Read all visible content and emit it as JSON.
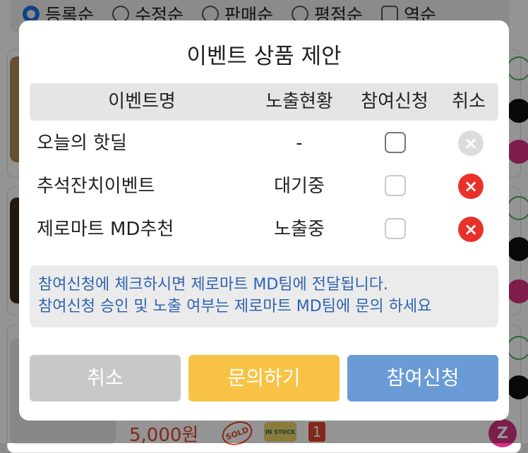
{
  "sort_options": [
    {
      "label": "등록순",
      "selected": true,
      "kind": "radio"
    },
    {
      "label": "수정순",
      "selected": false,
      "kind": "radio"
    },
    {
      "label": "판매순",
      "selected": false,
      "kind": "radio"
    },
    {
      "label": "평점순",
      "selected": false,
      "kind": "radio"
    },
    {
      "label": "역순",
      "selected": false,
      "kind": "checkbox"
    }
  ],
  "background_product": {
    "price": "5,000원",
    "sold_badge": "SOLD",
    "instock_badge": "IN STOCK",
    "count_badge": "1",
    "z_badge": "Z"
  },
  "modal": {
    "title": "이벤트 상품 제안",
    "columns": {
      "name": "이벤트명",
      "exposure": "노출현황",
      "join": "참여신청",
      "cancel": "취소"
    },
    "rows": [
      {
        "name": "오늘의 핫딜",
        "exposure": "-",
        "join_checked": false,
        "checkbox_style": "enabled",
        "cancel_active": false
      },
      {
        "name": "추석잔치이벤트",
        "exposure": "대기중",
        "join_checked": false,
        "checkbox_style": "disabled",
        "cancel_active": true
      },
      {
        "name": "제로마트 MD추천",
        "exposure": "노출중",
        "join_checked": false,
        "checkbox_style": "disabled",
        "cancel_active": true
      }
    ],
    "notice_lines": [
      "참여신청에 체크하시면 제로마트 MD팀에 전달됩니다.",
      "참여신청 승인 및 노출 여부는 제로마트 MD팀에 문의 하세요"
    ],
    "buttons": {
      "cancel": "취소",
      "inquiry": "문의하기",
      "join": "참여신청"
    },
    "cancel_icon": "×"
  },
  "colors": {
    "accent_blue": "#1e73e8",
    "cancel_red": "#e8312a",
    "cancel_gray": "#dcdcdc",
    "notice_text": "#2d64b0",
    "inquiry_yellow": "#f8c345",
    "join_blue": "#6a9bd7"
  }
}
